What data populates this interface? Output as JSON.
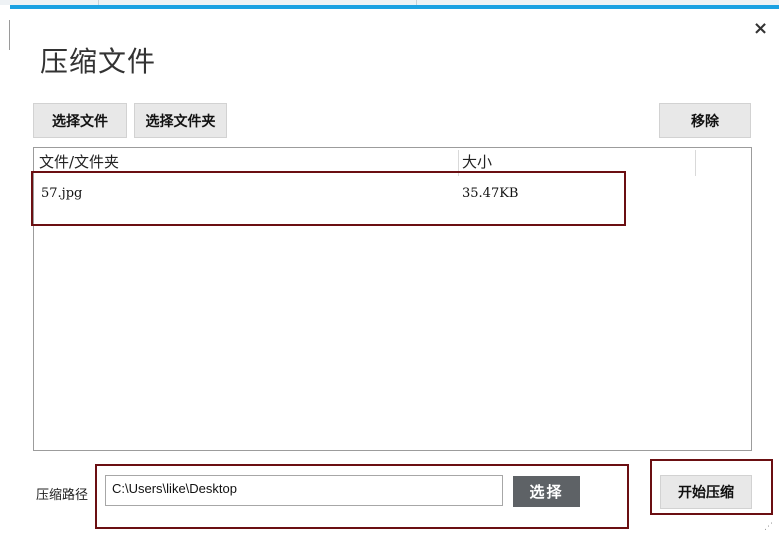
{
  "dialog": {
    "title": "压缩文件",
    "close_label": "×"
  },
  "toolbar": {
    "choose_file_label": "选择文件",
    "choose_folder_label": "选择文件夹",
    "remove_label": "移除"
  },
  "list": {
    "columns": [
      "文件/文件夹",
      "大小"
    ],
    "rows": [
      {
        "name": "57.jpg",
        "size": "35.47KB"
      }
    ]
  },
  "compress_path": {
    "label": "压缩路径",
    "value": "C:\\Users\\like\\Desktop",
    "select_label": "选择"
  },
  "start_button_label": "开始压缩",
  "colors": {
    "accent": "#1ba1e2",
    "highlight": "#6b0f12",
    "select_button": "#5e6266"
  }
}
